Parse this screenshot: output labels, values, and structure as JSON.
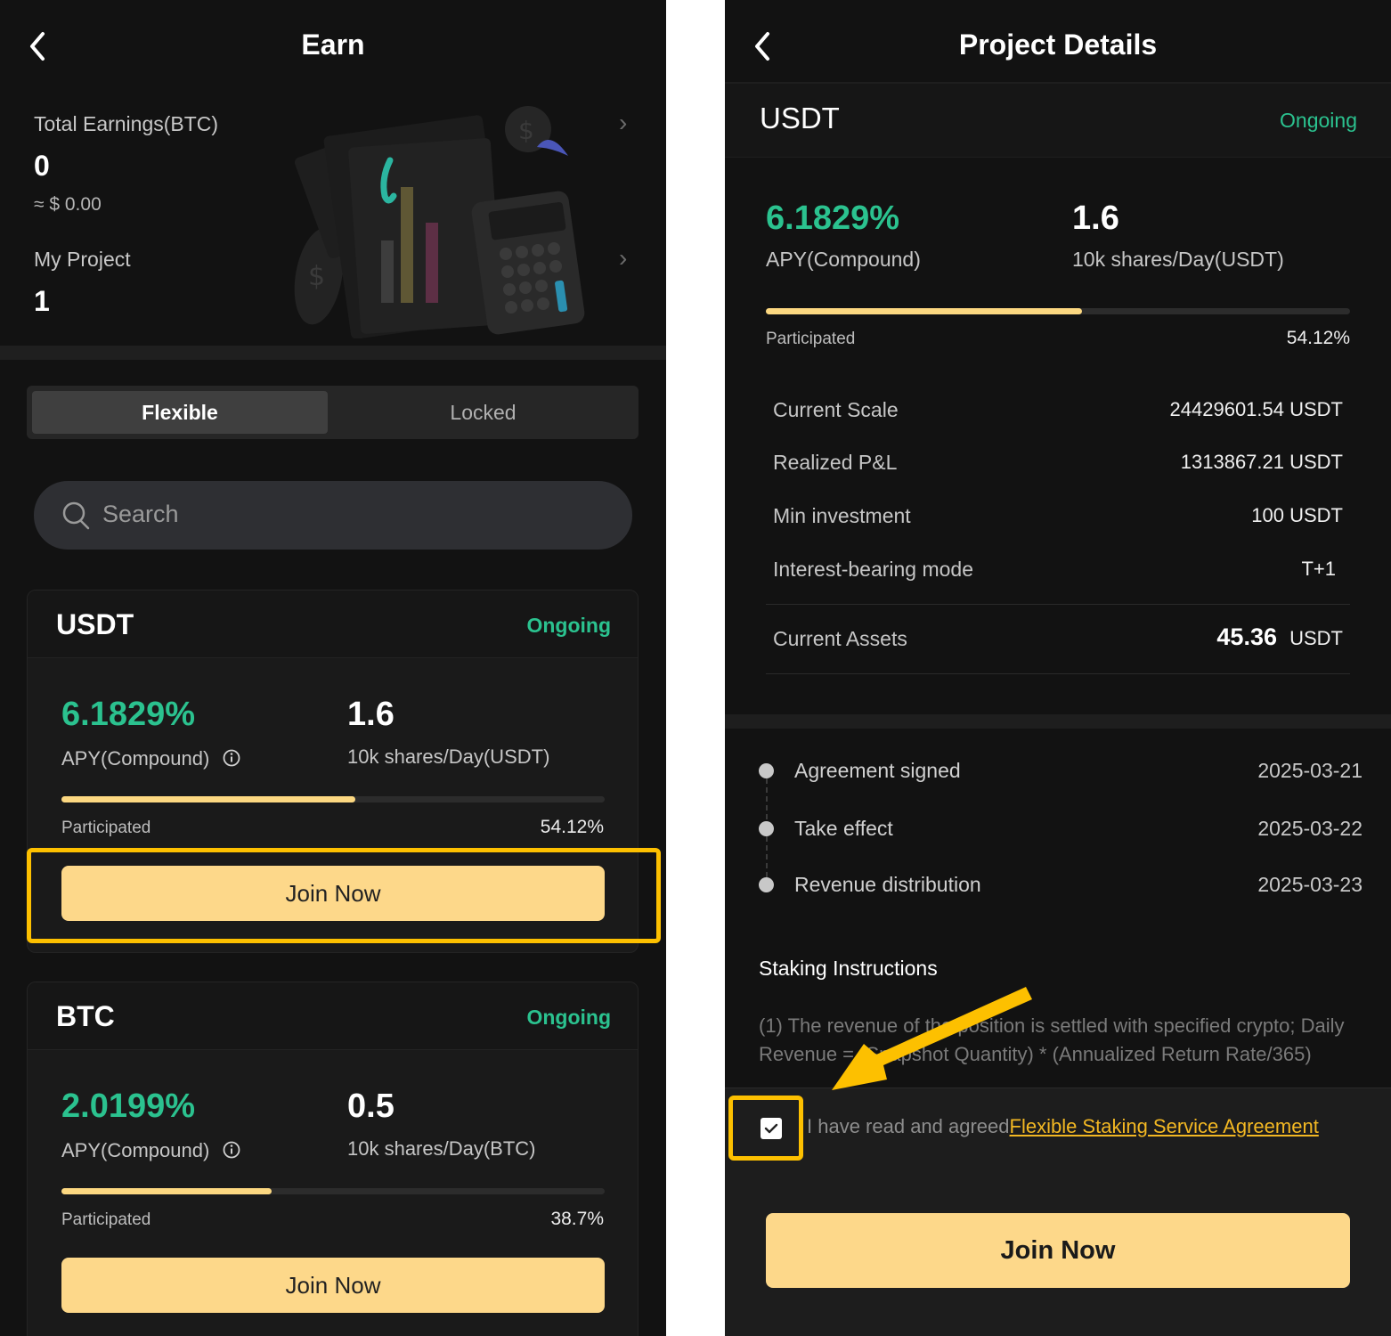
{
  "earn": {
    "title": "Earn",
    "total_earnings_label": "Total Earnings(BTC)",
    "total_earnings_value": "0",
    "total_earnings_fiat": "≈ $ 0.00",
    "my_project_label": "My Project",
    "my_project_value": "1",
    "tabs": [
      "Flexible",
      "Locked"
    ],
    "active_tab": "Flexible",
    "search_placeholder": "Search",
    "cards": [
      {
        "name": "USDT",
        "status": "Ongoing",
        "apy": "6.1829%",
        "apy_label": "APY(Compound)",
        "shares": "1.6",
        "shares_label": "10k shares/Day(USDT)",
        "participated_label": "Participated",
        "participated": "54.12%",
        "progress": 0.5412,
        "button": "Join Now"
      },
      {
        "name": "BTC",
        "status": "Ongoing",
        "apy": "2.0199%",
        "apy_label": "APY(Compound)",
        "shares": "0.5",
        "shares_label": "10k shares/Day(BTC)",
        "participated_label": "Participated",
        "participated": "38.7%",
        "progress": 0.387,
        "button": "Join Now"
      }
    ]
  },
  "details": {
    "title": "Project Details",
    "name": "USDT",
    "status": "Ongoing",
    "apy": "6.1829%",
    "apy_label": "APY(Compound)",
    "shares": "1.6",
    "shares_label": "10k shares/Day(USDT)",
    "participated_label": "Participated",
    "participated": "54.12%",
    "progress": 0.5412,
    "rows": [
      {
        "label": "Current Scale",
        "value": "24429601.54 USDT"
      },
      {
        "label": "Realized P&L",
        "value": "1313867.21 USDT"
      },
      {
        "label": "Min investment",
        "value": "100 USDT"
      },
      {
        "label": "Interest-bearing mode",
        "value": "T+1"
      }
    ],
    "current_assets_label": "Current Assets",
    "current_assets_value": "45.36",
    "current_assets_unit": "USDT",
    "timeline": [
      {
        "label": "Agreement signed",
        "date": "2025-03-21"
      },
      {
        "label": "Take effect",
        "date": "2025-03-22"
      },
      {
        "label": "Revenue distribution",
        "date": "2025-03-23"
      }
    ],
    "staking_title": "Staking Instructions",
    "staking_text": "(1) The revenue of the position is settled with specified crypto; Daily Revenue = (Snapshot Quantity) * (Annualized Return Rate/365)",
    "agree_prefix": "I have read and agreed",
    "agree_link": "Flexible Staking Service Agreement",
    "agree_checked": true,
    "button": "Join Now"
  },
  "colors": {
    "accent_green": "#2bc28f",
    "button_yellow": "#fdd88a",
    "highlight": "#fdc000"
  }
}
